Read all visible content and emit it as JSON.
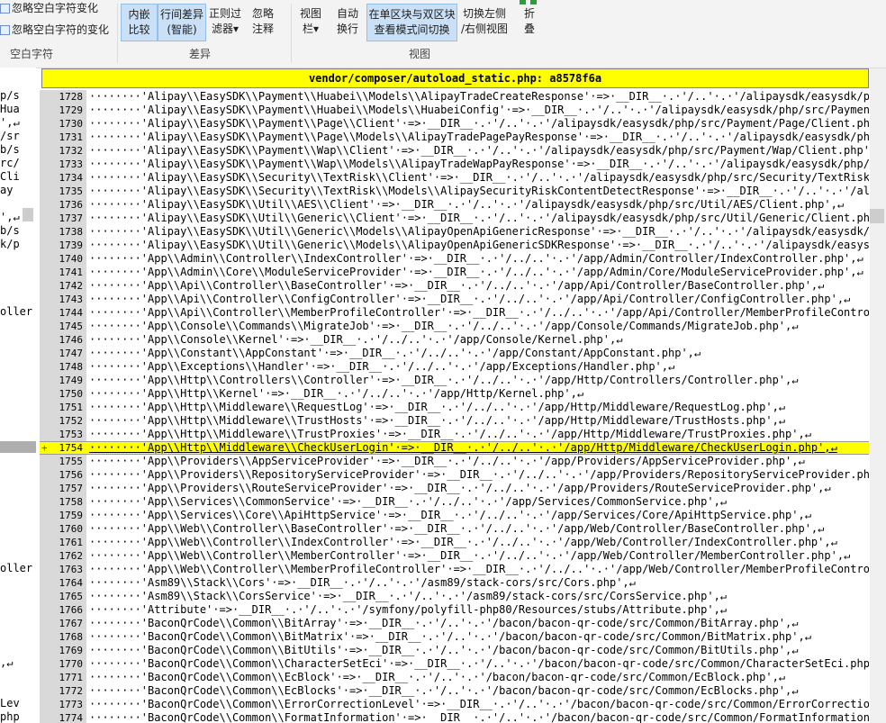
{
  "ribbon": {
    "whitespace_group": {
      "option1": "忽略空白字符变化",
      "option2": "忽略空白字符的变化",
      "label": "空白字符"
    },
    "diff_group": {
      "inline_compare_l1": "内嵌",
      "inline_compare_l2": "比较",
      "line_diff_l1": "行间差异",
      "line_diff_l2": "(智能)",
      "regex_filter_l1": "正则过",
      "regex_filter_l2": "滤器",
      "ignore_comments_l1": "忽略",
      "ignore_comments_l2": "注释",
      "label": "差异"
    },
    "view_group": {
      "view_bar_l1": "视图",
      "view_bar_l2": "栏",
      "auto_wrap_l1": "自动",
      "auto_wrap_l2": "换行",
      "single_double_l1": "在单区块与双区块",
      "single_double_l2": "查看模式间切换",
      "switch_lr_l1": "切换左侧",
      "switch_lr_l2": "/右侧视图",
      "fold_l1": "折",
      "fold_l2": "叠",
      "label": "视图"
    }
  },
  "left_pane": {
    "fragments": [
      "p/s",
      "Hua",
      "',↵",
      "/sr",
      "b/s",
      "rc/",
      "Cli",
      "ay",
      "',↵",
      "b/s",
      "k/p",
      "oller",
      "oller",
      ",↵",
      "Lev",
      "php"
    ]
  },
  "file_header": "vendor/composer/autoload_static.php: a8578f6a",
  "lines": [
    {
      "n": "1728",
      "t": "········'Alipay\\\\EasySDK\\\\Payment\\\\Huabei\\\\Models\\\\AlipayTradeCreateResponse'·=>·__DIR__·.·'/..'·.·'/alipaysdk/easysdk/php/src"
    },
    {
      "n": "1729",
      "t": "········'Alipay\\\\EasySDK\\\\Payment\\\\Huabei\\\\Models\\\\HuabeiConfig'·=>·__DIR__·.·'/..'·.·'/alipaysdk/easysdk/php/src/Payment/Hua"
    },
    {
      "n": "1730",
      "t": "········'Alipay\\\\EasySDK\\\\Payment\\\\Page\\\\Client'·=>·__DIR__·.·'/..'·.·'/alipaysdk/easysdk/php/src/Payment/Page/Client.php',↵"
    },
    {
      "n": "1731",
      "t": "········'Alipay\\\\EasySDK\\\\Payment\\\\Page\\\\Models\\\\AlipayTradePagePayResponse'·=>·__DIR__·.·'/..'·.·'/alipaysdk/easysdk/php/src/"
    },
    {
      "n": "1732",
      "t": "········'Alipay\\\\EasySDK\\\\Payment\\\\Wap\\\\Client'·=>·__DIR__·.·'/..'·.·'/alipaysdk/easysdk/php/src/Payment/Wap/Client.php',↵"
    },
    {
      "n": "1733",
      "t": "········'Alipay\\\\EasySDK\\\\Payment\\\\Wap\\\\Models\\\\AlipayTradeWapPayResponse'·=>·__DIR__·.·'/..'·.·'/alipaysdk/easysdk/php/src/P"
    },
    {
      "n": "1734",
      "t": "········'Alipay\\\\EasySDK\\\\Security\\\\TextRisk\\\\Client'·=>·__DIR__·.·'/..'·.·'/alipaysdk/easysdk/php/src/Security/TextRisk/Clie"
    },
    {
      "n": "1735",
      "t": "········'Alipay\\\\EasySDK\\\\Security\\\\TextRisk\\\\Models\\\\AlipaySecurityRiskContentDetectResponse'·=>·__DIR__·.·'/..'·.·'/alipays"
    },
    {
      "n": "1736",
      "t": "········'Alipay\\\\EasySDK\\\\Util\\\\AES\\\\Client'·=>·__DIR__·.·'/..'·.·'/alipaysdk/easysdk/php/src/Util/AES/Client.php',↵"
    },
    {
      "n": "1737",
      "t": "········'Alipay\\\\EasySDK\\\\Util\\\\Generic\\\\Client'·=>·__DIR__·.·'/..'·.·'/alipaysdk/easysdk/php/src/Util/Generic/Client.php',↵"
    },
    {
      "n": "1738",
      "t": "········'Alipay\\\\EasySDK\\\\Util\\\\Generic\\\\Models\\\\AlipayOpenApiGenericResponse'·=>·__DIR__·.·'/..'·.·'/alipaysdk/easysdk/p"
    },
    {
      "n": "1739",
      "t": "········'Alipay\\\\EasySDK\\\\Util\\\\Generic\\\\Models\\\\AlipayOpenApiGenericSDKResponse'·=>·__DIR__·.·'/..'·.·'/alipaysdk/easysdk/"
    },
    {
      "n": "1740",
      "t": "········'App\\\\Admin\\\\Controller\\\\IndexController'·=>·__DIR__·.·'/../..'·.·'/app/Admin/Controller/IndexController.php',↵"
    },
    {
      "n": "1741",
      "t": "········'App\\\\Admin\\\\Core\\\\ModuleServiceProvider'·=>·__DIR__·.·'/../..'·.·'/app/Admin/Core/ModuleServiceProvider.php',↵"
    },
    {
      "n": "1742",
      "t": "········'App\\\\Api\\\\Controller\\\\BaseController'·=>·__DIR__·.·'/../..'·.·'/app/Api/Controller/BaseController.php',↵"
    },
    {
      "n": "1743",
      "t": "········'App\\\\Api\\\\Controller\\\\ConfigController'·=>·__DIR__·.·'/../..'·.·'/app/Api/Controller/ConfigController.php',↵"
    },
    {
      "n": "1744",
      "t": "········'App\\\\Api\\\\Controller\\\\MemberProfileController'·=>·__DIR__·.·'/../..'·.·'/app/Api/Controller/MemberProfileController"
    },
    {
      "n": "1745",
      "t": "········'App\\\\Console\\\\Commands\\\\MigrateJob'·=>·__DIR__·.·'/../..'·.·'/app/Console/Commands/MigrateJob.php',↵"
    },
    {
      "n": "1746",
      "t": "········'App\\\\Console\\\\Kernel'·=>·__DIR__·.·'/../..'·.·'/app/Console/Kernel.php',↵"
    },
    {
      "n": "1747",
      "t": "········'App\\\\Constant\\\\AppConstant'·=>·__DIR__·.·'/../..'·.·'/app/Constant/AppConstant.php',↵"
    },
    {
      "n": "1748",
      "t": "········'App\\\\Exceptions\\\\Handler'·=>·__DIR__·.·'/../..'·.·'/app/Exceptions/Handler.php',↵"
    },
    {
      "n": "1749",
      "t": "········'App\\\\Http\\\\Controllers\\\\Controller'·=>·__DIR__·.·'/../..'·.·'/app/Http/Controllers/Controller.php',↵"
    },
    {
      "n": "1750",
      "t": "········'App\\\\Http\\\\Kernel'·=>·__DIR__·.·'/../..'·.·'/app/Http/Kernel.php',↵"
    },
    {
      "n": "1751",
      "t": "········'App\\\\Http\\\\Middleware\\\\RequestLog'·=>·__DIR__·.·'/../..'·.·'/app/Http/Middleware/RequestLog.php',↵"
    },
    {
      "n": "1752",
      "t": "········'App\\\\Http\\\\Middleware\\\\TrustHosts'·=>·__DIR__·.·'/../..'·.·'/app/Http/Middleware/TrustHosts.php',↵"
    },
    {
      "n": "1753",
      "t": "········'App\\\\Http\\\\Middleware\\\\TrustProxies'·=>·__DIR__·.·'/../..'·.·'/app/Http/Middleware/TrustProxies.php',↵"
    },
    {
      "n": "1754",
      "t": "········'App\\\\Http\\\\Middleware\\\\CheckUserLogin'·=>·__DIR__·.·'/../..'·.·'/app/Http/Middleware/CheckUserLogin.php',↵",
      "highlight": true,
      "marker": "+"
    },
    {
      "n": "1755",
      "t": "········'App\\\\Providers\\\\AppServiceProvider'·=>·__DIR__·.·'/../..'·.·'/app/Providers/AppServiceProvider.php',↵"
    },
    {
      "n": "1756",
      "t": "········'App\\\\Providers\\\\RepositoryServiceProvider'·=>·__DIR__·.·'/../..'·.·'/app/Providers/RepositoryServiceProvider.php',↵"
    },
    {
      "n": "1757",
      "t": "········'App\\\\Providers\\\\RouteServiceProvider'·=>·__DIR__·.·'/../..'·.·'/app/Providers/RouteServiceProvider.php',↵"
    },
    {
      "n": "1758",
      "t": "········'App\\\\Services\\\\CommonService'·=>·__DIR__·.·'/../..'·.·'/app/Services/CommonService.php',↵"
    },
    {
      "n": "1759",
      "t": "········'App\\\\Services\\\\Core\\\\ApiHttpService'·=>·__DIR__·.·'/../..'·.·'/app/Services/Core/ApiHttpService.php',↵"
    },
    {
      "n": "1760",
      "t": "········'App\\\\Web\\\\Controller\\\\BaseController'·=>·__DIR__·.·'/../..'·.·'/app/Web/Controller/BaseController.php',↵"
    },
    {
      "n": "1761",
      "t": "········'App\\\\Web\\\\Controller\\\\IndexController'·=>·__DIR__·.·'/../..'·.·'/app/Web/Controller/IndexController.php',↵"
    },
    {
      "n": "1762",
      "t": "········'App\\\\Web\\\\Controller\\\\MemberController'·=>·__DIR__·.·'/../..'·.·'/app/Web/Controller/MemberController.php',↵"
    },
    {
      "n": "1763",
      "t": "········'App\\\\Web\\\\Controller\\\\MemberProfileController'·=>·__DIR__·.·'/../..'·.·'/app/Web/Controller/MemberProfileController"
    },
    {
      "n": "1764",
      "t": "········'Asm89\\\\Stack\\\\Cors'·=>·__DIR__·.·'/..'·.·'/asm89/stack-cors/src/Cors.php',↵"
    },
    {
      "n": "1765",
      "t": "········'Asm89\\\\Stack\\\\CorsService'·=>·__DIR__·.·'/..'·.·'/asm89/stack-cors/src/CorsService.php',↵"
    },
    {
      "n": "1766",
      "t": "········'Attribute'·=>·__DIR__·.·'/..'·.·'/symfony/polyfill-php80/Resources/stubs/Attribute.php',↵"
    },
    {
      "n": "1767",
      "t": "········'BaconQrCode\\\\Common\\\\BitArray'·=>·__DIR__·.·'/..'·.·'/bacon/bacon-qr-code/src/Common/BitArray.php',↵"
    },
    {
      "n": "1768",
      "t": "········'BaconQrCode\\\\Common\\\\BitMatrix'·=>·__DIR__·.·'/..'·.·'/bacon/bacon-qr-code/src/Common/BitMatrix.php',↵"
    },
    {
      "n": "1769",
      "t": "········'BaconQrCode\\\\Common\\\\BitUtils'·=>·__DIR__·.·'/..'·.·'/bacon/bacon-qr-code/src/Common/BitUtils.php',↵"
    },
    {
      "n": "1770",
      "t": "········'BaconQrCode\\\\Common\\\\CharacterSetEci'·=>·__DIR__·.·'/..'·.·'/bacon/bacon-qr-code/src/Common/CharacterSetEci.php',↵"
    },
    {
      "n": "1771",
      "t": "········'BaconQrCode\\\\Common\\\\EcBlock'·=>·__DIR__·.·'/..'·.·'/bacon/bacon-qr-code/src/Common/EcBlock.php',↵"
    },
    {
      "n": "1772",
      "t": "········'BaconQrCode\\\\Common\\\\EcBlocks'·=>·__DIR__·.·'/..'·.·'/bacon/bacon-qr-code/src/Common/EcBlocks.php',↵"
    },
    {
      "n": "1773",
      "t": "········'BaconQrCode\\\\Common\\\\ErrorCorrectionLevel'·=>·__DIR__·.·'/..'·.·'/bacon/bacon-qr-code/src/Common/ErrorCorrectionLeve"
    },
    {
      "n": "1774",
      "t": "········'BaconQrCode\\\\Common\\\\FormatInformation'·=>·__DIR__·.·'/..'·.·'/bacon/bacon-qr-code/src/Common/FormatInformation.php"
    }
  ],
  "colors": {
    "highlight": "#ffff00",
    "ribbon_bg": "#f3f3f3",
    "active_button_bg": "#c9e0f7",
    "gutter_bg": "#d9d9d9"
  }
}
